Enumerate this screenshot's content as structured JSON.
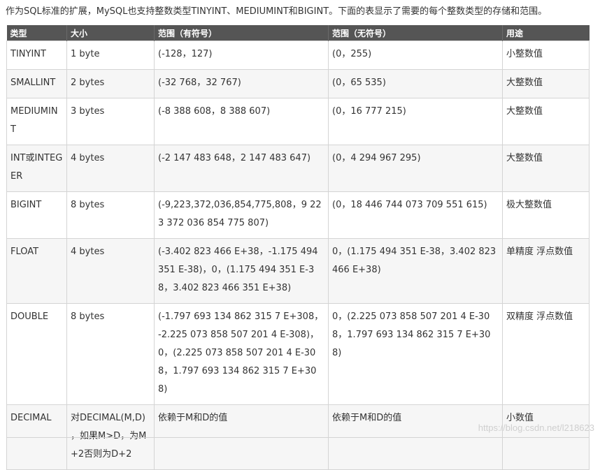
{
  "intro": "作为SQL标准的扩展，MySQL也支持整数类型TINYINT、MEDIUMINT和BIGINT。下面的表显示了需要的每个整数类型的存储和范围。",
  "table": {
    "headers": [
      "类型",
      "大小",
      "范围（有符号）",
      "范围（无符号）",
      "用途"
    ],
    "rows": [
      {
        "type": "TINYINT",
        "size": "1 byte",
        "signed": "(-128，127)",
        "unsigned": "(0，255)",
        "usage": "小整数值"
      },
      {
        "type": "SMALLINT",
        "size": "2 bytes",
        "signed": "(-32 768，32 767)",
        "unsigned": "(0，65 535)",
        "usage": "大整数值"
      },
      {
        "type": "MEDIUMINT",
        "size": "3 bytes",
        "signed": "(-8 388 608，8 388 607)",
        "unsigned": "(0，16 777 215)",
        "usage": "大整数值"
      },
      {
        "type": "INT或INTEGER",
        "size": "4 bytes",
        "signed": "(-2 147 483 648，2 147 483 647)",
        "unsigned": "(0，4 294 967 295)",
        "usage": "大整数值"
      },
      {
        "type": "BIGINT",
        "size": "8 bytes",
        "signed": "(-9,223,372,036,854,775,808，9 223 372 036 854 775 807)",
        "unsigned": "(0，18 446 744 073 709 551 615)",
        "usage": "极大整数值"
      },
      {
        "type": "FLOAT",
        "size": "4 bytes",
        "signed": "(-3.402 823 466 E+38，-1.175 494 351 E-38)，0，(1.175 494 351 E-38，3.402 823 466 351 E+38)",
        "unsigned": "0，(1.175 494 351 E-38，3.402 823 466 E+38)",
        "usage": "单精度 浮点数值"
      },
      {
        "type": "DOUBLE",
        "size": "8 bytes",
        "signed": "(-1.797 693 134 862 315 7 E+308，-2.225 073 858 507 201 4 E-308)，0，(2.225 073 858 507 201 4 E-308，1.797 693 134 862 315 7 E+308)",
        "unsigned": "0，(2.225 073 858 507 201 4 E-308，1.797 693 134 862 315 7 E+308)",
        "usage": "双精度 浮点数值"
      },
      {
        "type": "DECIMAL",
        "size": "对DECIMAL(M,D) ，如果M>D，为M+2否则为D+2",
        "signed": "依赖于M和D的值",
        "unsigned": "依赖于M和D的值",
        "usage": "小数值"
      }
    ]
  },
  "watermark": "https://blog.csdn.net/l218623"
}
